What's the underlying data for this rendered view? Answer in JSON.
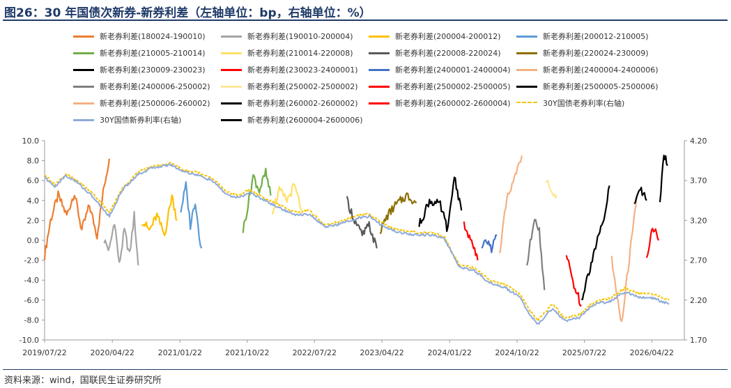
{
  "title": "图26：30 年国债次新券-新券利差（左轴单位：bp，右轴单位：%）",
  "source": "资料来源：wind，国联民生证券研究所",
  "chart_data": {
    "type": "line",
    "x_ticks": [
      "2019/07/22",
      "2020/04/22",
      "2021/01/22",
      "2021/10/22",
      "2022/07/22",
      "2023/04/22",
      "2024/01/22",
      "2024/10/22",
      "2025/07/22",
      "2026/04/22"
    ],
    "y_left": {
      "min": -10,
      "max": 10,
      "step": 2,
      "ticks": [
        "10.0",
        "8.0",
        "6.0",
        "4.0",
        "2.0",
        "0.0",
        "-2.0",
        "-4.0",
        "-6.0",
        "-8.0",
        "-10.0"
      ]
    },
    "y_right": {
      "min": 1.7,
      "max": 4.2,
      "step": 0.5,
      "ticks": [
        "4.20",
        "3.70",
        "3.20",
        "2.70",
        "2.20",
        "1.70"
      ]
    },
    "grid": false,
    "legend_position": "top",
    "series": [
      {
        "name": "新老券利差(180024-190010)",
        "color": "#ed7d31",
        "axis": "left",
        "points": [
          [
            "2019/07/22",
            -1.5
          ],
          [
            "2019/08/15",
            2.0
          ],
          [
            "2019/09/15",
            4.5
          ],
          [
            "2019/10/20",
            2.5
          ],
          [
            "2019/11/20",
            4.8
          ],
          [
            "2019/12/20",
            1.0
          ],
          [
            "2020/01/20",
            3.5
          ],
          [
            "2020/02/20",
            0.5
          ],
          [
            "2020/03/20",
            5.5
          ],
          [
            "2020/04/10",
            8.2
          ]
        ]
      },
      {
        "name": "新老券利差(190010-200004)",
        "color": "#a5a5a5",
        "axis": "left",
        "points": [
          [
            "2020/03/20",
            0.0
          ],
          [
            "2020/04/10",
            -1.0
          ],
          [
            "2020/05/01",
            2.0
          ],
          [
            "2020/05/20",
            -2.5
          ],
          [
            "2020/06/10",
            1.0
          ],
          [
            "2020/07/01",
            -1.5
          ],
          [
            "2020/07/20",
            2.5
          ],
          [
            "2020/08/05",
            -2.5
          ]
        ]
      },
      {
        "name": "新老券利差(200004-200012)",
        "color": "#ffc000",
        "axis": "left",
        "points": [
          [
            "2020/08/20",
            2.0
          ],
          [
            "2020/09/20",
            1.0
          ],
          [
            "2020/10/20",
            2.5
          ],
          [
            "2020/11/20",
            0.5
          ],
          [
            "2020/12/20",
            4.5
          ],
          [
            "2021/01/10",
            2.0
          ]
        ]
      },
      {
        "name": "新老券利差(200012-210005)",
        "color": "#5b9bd5",
        "axis": "left",
        "points": [
          [
            "2021/01/25",
            3.0
          ],
          [
            "2021/02/15",
            5.5
          ],
          [
            "2021/03/05",
            1.5
          ],
          [
            "2021/03/25",
            4.0
          ],
          [
            "2021/04/10",
            0.5
          ],
          [
            "2021/04/20",
            -0.8
          ]
        ]
      },
      {
        "name": "新老券利差(210005-210014)",
        "color": "#70ad47",
        "axis": "left",
        "points": [
          [
            "2021/10/05",
            1.0
          ],
          [
            "2021/10/25",
            3.5
          ],
          [
            "2021/11/15",
            6.5
          ],
          [
            "2021/12/10",
            5.0
          ],
          [
            "2022/01/05",
            6.8
          ],
          [
            "2022/01/25",
            4.5
          ]
        ]
      },
      {
        "name": "新老券利差(210014-220008)",
        "color": "#ffe066",
        "axis": "left",
        "points": [
          [
            "2022/02/01",
            3.0
          ],
          [
            "2022/03/01",
            5.0
          ],
          [
            "2022/04/01",
            4.0
          ],
          [
            "2022/05/01",
            5.5
          ],
          [
            "2022/06/01",
            3.0
          ]
        ]
      },
      {
        "name": "新老券利差(220008-220024)",
        "color": "#595959",
        "axis": "left",
        "points": [
          [
            "2022/12/01",
            4.0
          ],
          [
            "2023/01/01",
            2.0
          ],
          [
            "2023/02/01",
            0.5
          ],
          [
            "2023/03/01",
            1.5
          ],
          [
            "2023/04/01",
            -0.8
          ]
        ]
      },
      {
        "name": "新老券利差(220024-230009)",
        "color": "#8b6f00",
        "axis": "left",
        "points": [
          [
            "2023/04/15",
            1.0
          ],
          [
            "2023/05/15",
            2.5
          ],
          [
            "2023/06/15",
            3.5
          ],
          [
            "2023/08/01",
            4.5
          ],
          [
            "2023/09/10",
            3.8
          ]
        ]
      },
      {
        "name": "新老券利差(230009-230023)",
        "color": "#000000",
        "axis": "left",
        "points": [
          [
            "2023/09/20",
            1.5
          ],
          [
            "2023/11/01",
            4.0
          ],
          [
            "2023/12/15",
            3.5
          ],
          [
            "2024/01/15",
            1.0
          ],
          [
            "2024/02/10",
            6.5
          ],
          [
            "2024/03/10",
            3.0
          ]
        ]
      },
      {
        "name": "新老券利差(230023-2400001)",
        "color": "#ff0000",
        "axis": "left",
        "points": [
          [
            "2024/03/20",
            1.5
          ],
          [
            "2024/04/20",
            0.0
          ],
          [
            "2024/05/15",
            -2.0
          ]
        ]
      },
      {
        "name": "新老券利差(2400001-2400004)",
        "color": "#4472c4",
        "axis": "left",
        "points": [
          [
            "2024/06/01",
            -1.0
          ],
          [
            "2024/06/20",
            0.0
          ],
          [
            "2024/07/10",
            -0.8
          ],
          [
            "2024/08/01",
            0.5
          ]
        ]
      },
      {
        "name": "新老券利差(2400004-2400006)",
        "color": "#f4b183",
        "axis": "left",
        "points": [
          [
            "2024/08/10",
            -1.5
          ],
          [
            "2024/09/10",
            4.0
          ],
          [
            "2024/10/10",
            6.0
          ],
          [
            "2024/11/10",
            8.5
          ]
        ]
      },
      {
        "name": "新老券利差(2400006-250002)",
        "color": "#7f7f7f",
        "axis": "left",
        "points": [
          [
            "2024/12/01",
            -2.5
          ],
          [
            "2025/01/01",
            2.5
          ],
          [
            "2025/01/20",
            1.0
          ],
          [
            "2025/02/10",
            -5.0
          ]
        ]
      },
      {
        "name": "新老券利差(250002-2500002)",
        "color": "#ffe699",
        "axis": "left",
        "points": [
          [
            "2025/02/15",
            6.0
          ],
          [
            "2025/03/10",
            5.0
          ],
          [
            "2025/04/01",
            4.5
          ]
        ]
      },
      {
        "name": "新老券利差(2500002-2500005)",
        "color": "#ff0000",
        "axis": "left",
        "points": [
          [
            "2025/05/10",
            -1.5
          ],
          [
            "2025/06/10",
            -4.5
          ],
          [
            "2025/07/10",
            -6.5
          ]
        ]
      },
      {
        "name": "新老券利差(2500005-2500006)",
        "color": "#000000",
        "axis": "left",
        "points": [
          [
            "2025/07/10",
            -6.0
          ],
          [
            "2025/09/01",
            -1.0
          ],
          [
            "2025/10/10",
            2.0
          ],
          [
            "2025/11/01",
            5.5
          ]
        ]
      },
      {
        "name": "新老券利差(2500006-260002)",
        "color": "#f4b183",
        "axis": "left",
        "points": [
          [
            "2025/11/10",
            -2.0
          ],
          [
            "2025/12/20",
            -8.5
          ],
          [
            "2026/01/20",
            -2.0
          ],
          [
            "2026/02/20",
            4.5
          ]
        ]
      },
      {
        "name": "新老券利差(260002-2600002)",
        "color": "#000000",
        "axis": "left",
        "points": [
          [
            "2026/02/10",
            3.5
          ],
          [
            "2026/03/10",
            5.0
          ],
          [
            "2026/04/01",
            4.0
          ]
        ]
      },
      {
        "name": "新老券利差(2600002-2600004)",
        "color": "#ff0000",
        "axis": "left",
        "points": [
          [
            "2026/04/01",
            -2.0
          ],
          [
            "2026/04/25",
            1.5
          ],
          [
            "2026/05/20",
            0.0
          ]
        ]
      },
      {
        "name": "新老券利差(2600004-2600006)",
        "color": "#000000",
        "axis": "left",
        "points": [
          [
            "2026/05/25",
            3.5
          ],
          [
            "2026/06/10",
            8.8
          ],
          [
            "2026/06/25",
            7.5
          ]
        ]
      },
      {
        "name": "30Y国债老券利率(右轴)",
        "color": "#f5c400",
        "axis": "right",
        "dashed": true,
        "points": [
          [
            "2019/07/22",
            3.78
          ],
          [
            "2019/09/01",
            3.65
          ],
          [
            "2019/10/15",
            3.78
          ],
          [
            "2019/12/01",
            3.7
          ],
          [
            "2020/02/01",
            3.55
          ],
          [
            "2020/04/10",
            3.3
          ],
          [
            "2020/06/01",
            3.6
          ],
          [
            "2020/08/01",
            3.8
          ],
          [
            "2020/10/01",
            3.88
          ],
          [
            "2020/12/15",
            3.92
          ],
          [
            "2021/02/01",
            3.84
          ],
          [
            "2021/04/01",
            3.8
          ],
          [
            "2021/06/01",
            3.74
          ],
          [
            "2021/08/01",
            3.55
          ],
          [
            "2021/09/15",
            3.52
          ],
          [
            "2021/11/01",
            3.58
          ],
          [
            "2022/01/01",
            3.48
          ],
          [
            "2022/03/01",
            3.4
          ],
          [
            "2022/05/01",
            3.3
          ],
          [
            "2022/07/01",
            3.32
          ],
          [
            "2022/09/01",
            3.15
          ],
          [
            "2022/11/01",
            3.18
          ],
          [
            "2023/01/01",
            3.25
          ],
          [
            "2023/03/01",
            3.28
          ],
          [
            "2023/05/01",
            3.15
          ],
          [
            "2023/07/01",
            3.08
          ],
          [
            "2023/09/01",
            3.05
          ],
          [
            "2023/11/01",
            3.05
          ],
          [
            "2024/01/01",
            3.0
          ],
          [
            "2024/02/01",
            2.8
          ],
          [
            "2024/03/01",
            2.65
          ],
          [
            "2024/05/01",
            2.6
          ],
          [
            "2024/07/01",
            2.45
          ],
          [
            "2024/09/01",
            2.4
          ],
          [
            "2024/11/01",
            2.28
          ],
          [
            "2024/12/15",
            2.05
          ],
          [
            "2025/01/15",
            1.95
          ],
          [
            "2025/03/15",
            2.15
          ],
          [
            "2025/05/01",
            1.98
          ],
          [
            "2025/07/01",
            2.02
          ],
          [
            "2025/09/01",
            2.18
          ],
          [
            "2025/11/01",
            2.22
          ],
          [
            "2026/01/01",
            2.35
          ],
          [
            "2026/03/01",
            2.28
          ],
          [
            "2026/05/01",
            2.27
          ],
          [
            "2026/07/01",
            2.2
          ]
        ]
      },
      {
        "name": "30Y国债新券利率(右轴)",
        "color": "#8eaadb",
        "axis": "right",
        "points": [
          [
            "2019/07/22",
            3.74
          ],
          [
            "2019/09/01",
            3.62
          ],
          [
            "2019/10/15",
            3.76
          ],
          [
            "2019/12/01",
            3.68
          ],
          [
            "2020/02/01",
            3.5
          ],
          [
            "2020/04/10",
            3.25
          ],
          [
            "2020/06/01",
            3.58
          ],
          [
            "2020/08/01",
            3.77
          ],
          [
            "2020/10/01",
            3.86
          ],
          [
            "2020/12/15",
            3.9
          ],
          [
            "2021/02/01",
            3.82
          ],
          [
            "2021/04/01",
            3.77
          ],
          [
            "2021/06/01",
            3.7
          ],
          [
            "2021/08/01",
            3.52
          ],
          [
            "2021/09/15",
            3.48
          ],
          [
            "2021/11/01",
            3.55
          ],
          [
            "2022/01/01",
            3.45
          ],
          [
            "2022/03/01",
            3.36
          ],
          [
            "2022/05/01",
            3.27
          ],
          [
            "2022/07/01",
            3.28
          ],
          [
            "2022/09/01",
            3.12
          ],
          [
            "2022/11/01",
            3.15
          ],
          [
            "2023/01/01",
            3.22
          ],
          [
            "2023/03/01",
            3.25
          ],
          [
            "2023/05/01",
            3.12
          ],
          [
            "2023/07/01",
            3.05
          ],
          [
            "2023/09/01",
            3.02
          ],
          [
            "2023/11/01",
            3.02
          ],
          [
            "2024/01/01",
            2.97
          ],
          [
            "2024/02/01",
            2.78
          ],
          [
            "2024/03/01",
            2.62
          ],
          [
            "2024/05/01",
            2.57
          ],
          [
            "2024/07/01",
            2.42
          ],
          [
            "2024/09/01",
            2.36
          ],
          [
            "2024/11/01",
            2.24
          ],
          [
            "2024/12/15",
            2.0
          ],
          [
            "2025/01/15",
            1.9
          ],
          [
            "2025/03/15",
            2.1
          ],
          [
            "2025/05/01",
            1.94
          ],
          [
            "2025/07/01",
            1.98
          ],
          [
            "2025/09/01",
            2.15
          ],
          [
            "2025/11/01",
            2.18
          ],
          [
            "2026/01/01",
            2.3
          ],
          [
            "2026/03/01",
            2.24
          ],
          [
            "2026/05/01",
            2.22
          ],
          [
            "2026/07/01",
            2.15
          ]
        ]
      }
    ]
  }
}
